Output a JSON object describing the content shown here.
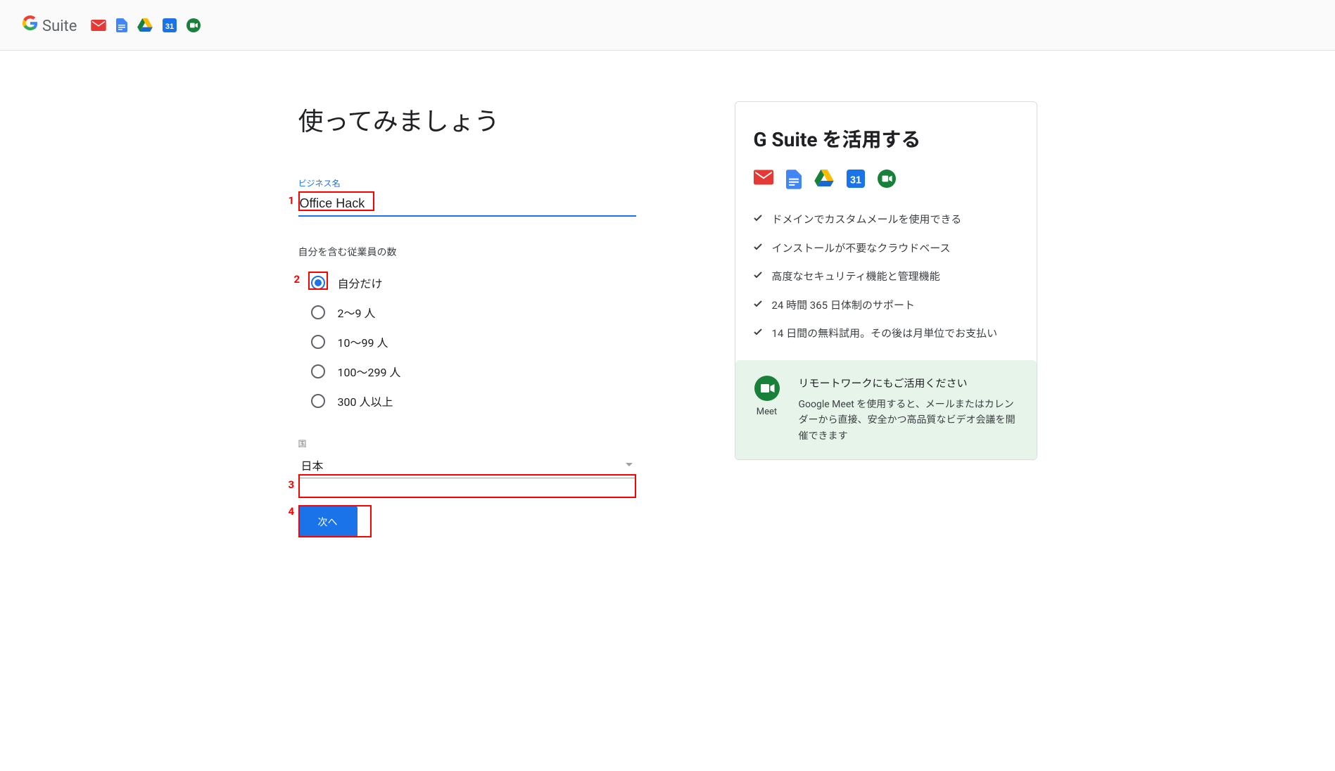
{
  "header": {
    "brand_suffix": "Suite"
  },
  "page": {
    "title": "使ってみましょう"
  },
  "business_name": {
    "label": "ビジネス名",
    "value": "Office Hack"
  },
  "employees": {
    "label": "自分を含む従業員の数",
    "options": [
      {
        "label": "自分だけ",
        "checked": true
      },
      {
        "label": "2〜9 人",
        "checked": false
      },
      {
        "label": "10〜99 人",
        "checked": false
      },
      {
        "label": "100〜299 人",
        "checked": false
      },
      {
        "label": "300 人以上",
        "checked": false
      }
    ]
  },
  "country": {
    "label": "国",
    "value": "日本"
  },
  "next_button": "次へ",
  "sidebar": {
    "title": "G Suite を活用する",
    "benefits": [
      "ドメインでカスタムメールを使用できる",
      "インストールが不要なクラウドベース",
      "高度なセキュリティ機能と管理機能",
      "24 時間 365 日体制のサポート",
      "14 日間の無料試用。その後は月単位でお支払い"
    ],
    "meet_label": "Meet",
    "meet_heading": "リモートワークにもご活用ください",
    "meet_body": "Google Meet を使用すると、メールまたはカレンダーから直接、安全かつ高品質なビデオ会議を開催できます"
  },
  "annotations": {
    "n1": "1",
    "n2": "2",
    "n3": "3",
    "n4": "4"
  }
}
